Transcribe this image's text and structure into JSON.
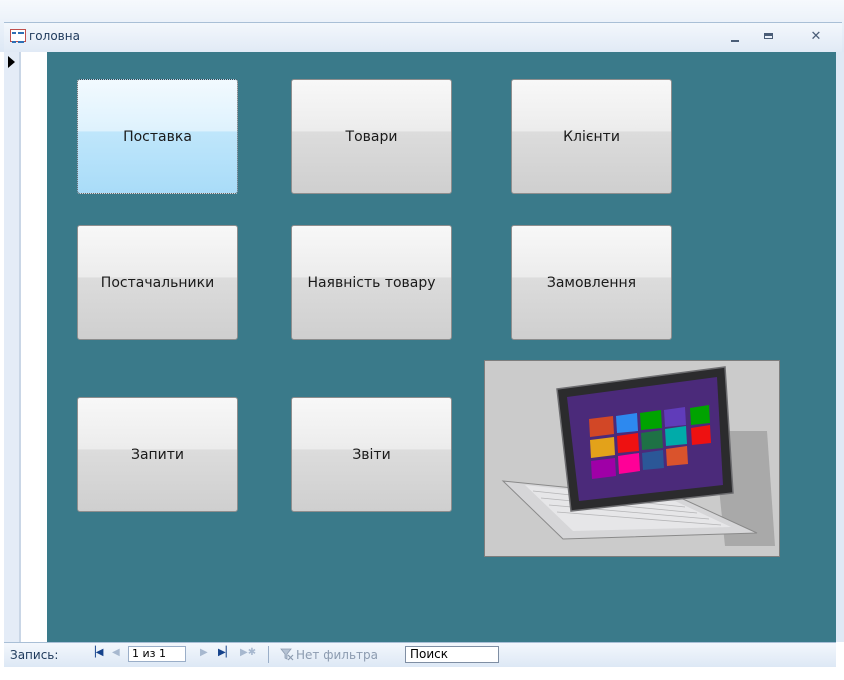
{
  "window": {
    "title": "головна"
  },
  "buttons": {
    "postavka": "Поставка",
    "tovary": "Товари",
    "klienty": "Клієнти",
    "postachalnyky": "Постачальники",
    "nayavnist": "Наявність товару",
    "zamovlennya": "Замовлення",
    "zapyty": "Запити",
    "zvity": "Звіти"
  },
  "picture": {
    "subject": "laptop-tablet-photo"
  },
  "navigation": {
    "record_label": "Запись:",
    "record_value": "1 из 1",
    "filter_label": "Нет фильтра",
    "search_placeholder": "Поиск"
  },
  "icons": {
    "form": "form-icon",
    "minimize": "minimize-icon",
    "maximize": "maximize-icon",
    "close": "close-icon",
    "first": "first-record-icon",
    "prev": "previous-record-icon",
    "next": "next-record-icon",
    "last": "last-record-icon",
    "new": "new-record-icon",
    "filter": "filter-icon"
  },
  "colors": {
    "form_background": "#3a7a8a",
    "active_button": "#bfe6fb"
  }
}
